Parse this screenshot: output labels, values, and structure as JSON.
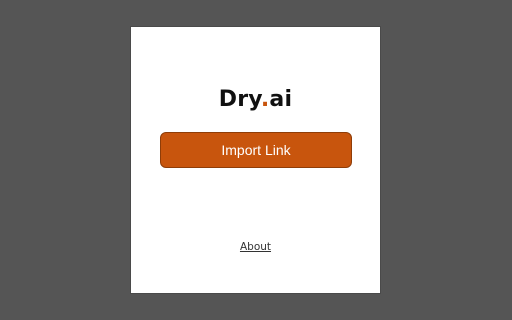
{
  "logo": {
    "part1": "Dry",
    "dot": ".",
    "part2": "ai"
  },
  "actions": {
    "import_label": "Import Link"
  },
  "footer": {
    "about_label": "About"
  },
  "colors": {
    "accent": "#c8550d",
    "backdrop": "#555555",
    "panel": "#ffffff"
  }
}
